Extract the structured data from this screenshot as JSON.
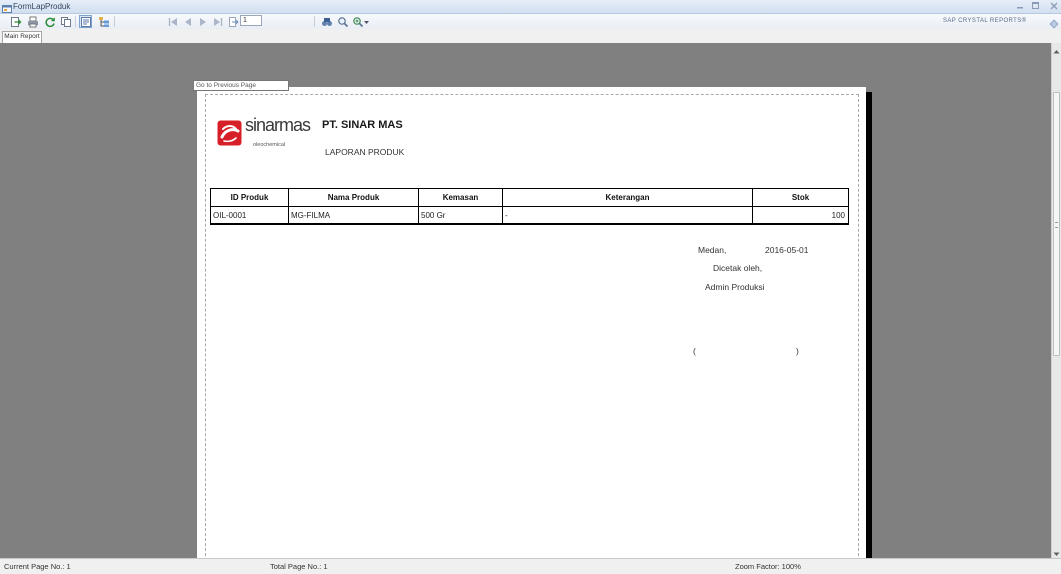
{
  "window": {
    "title": "FormLapProduk"
  },
  "toolbar": {
    "icons": [
      "export-icon",
      "print-icon",
      "refresh-icon",
      "copy-icon",
      "toggle-group-tree-icon",
      "toggle-parameter-panel-icon",
      "first-page-icon",
      "previous-page-icon",
      "next-page-icon",
      "last-page-icon",
      "go-to-page-icon",
      "find-icon",
      "search-icon",
      "zoom-icon"
    ],
    "page_number": "1",
    "brand": "SAP CRYSTAL REPORTS®"
  },
  "tabs": [
    {
      "label": "Main Report",
      "active": true
    }
  ],
  "tooltip": "Go to Previous Page",
  "report": {
    "logo": {
      "text": "sinarmas",
      "subtext": "oleochemical"
    },
    "company": "PT. SINAR MAS",
    "title": "LAPORAN PRODUK",
    "table": {
      "headers": [
        "ID Produk",
        "Nama Produk",
        "Kemasan",
        "Keterangan",
        "Stok"
      ],
      "rows": [
        [
          "OIL-0001",
          "MG-FILMA",
          "500 Gr",
          "-",
          "100"
        ]
      ]
    },
    "signature": {
      "city": "Medan,",
      "date": "2016-05-01",
      "printed_by": "Dicetak oleh,",
      "role": "Admin Produksi",
      "open_paren": "(",
      "close_paren": ")"
    }
  },
  "status_bar": {
    "current_page": "Current Page No.: 1",
    "total_page": "Total Page No.: 1",
    "zoom": "Zoom Factor: 100%"
  },
  "colors": {
    "workspace": "#808080",
    "logo_red": "#d71f27"
  }
}
